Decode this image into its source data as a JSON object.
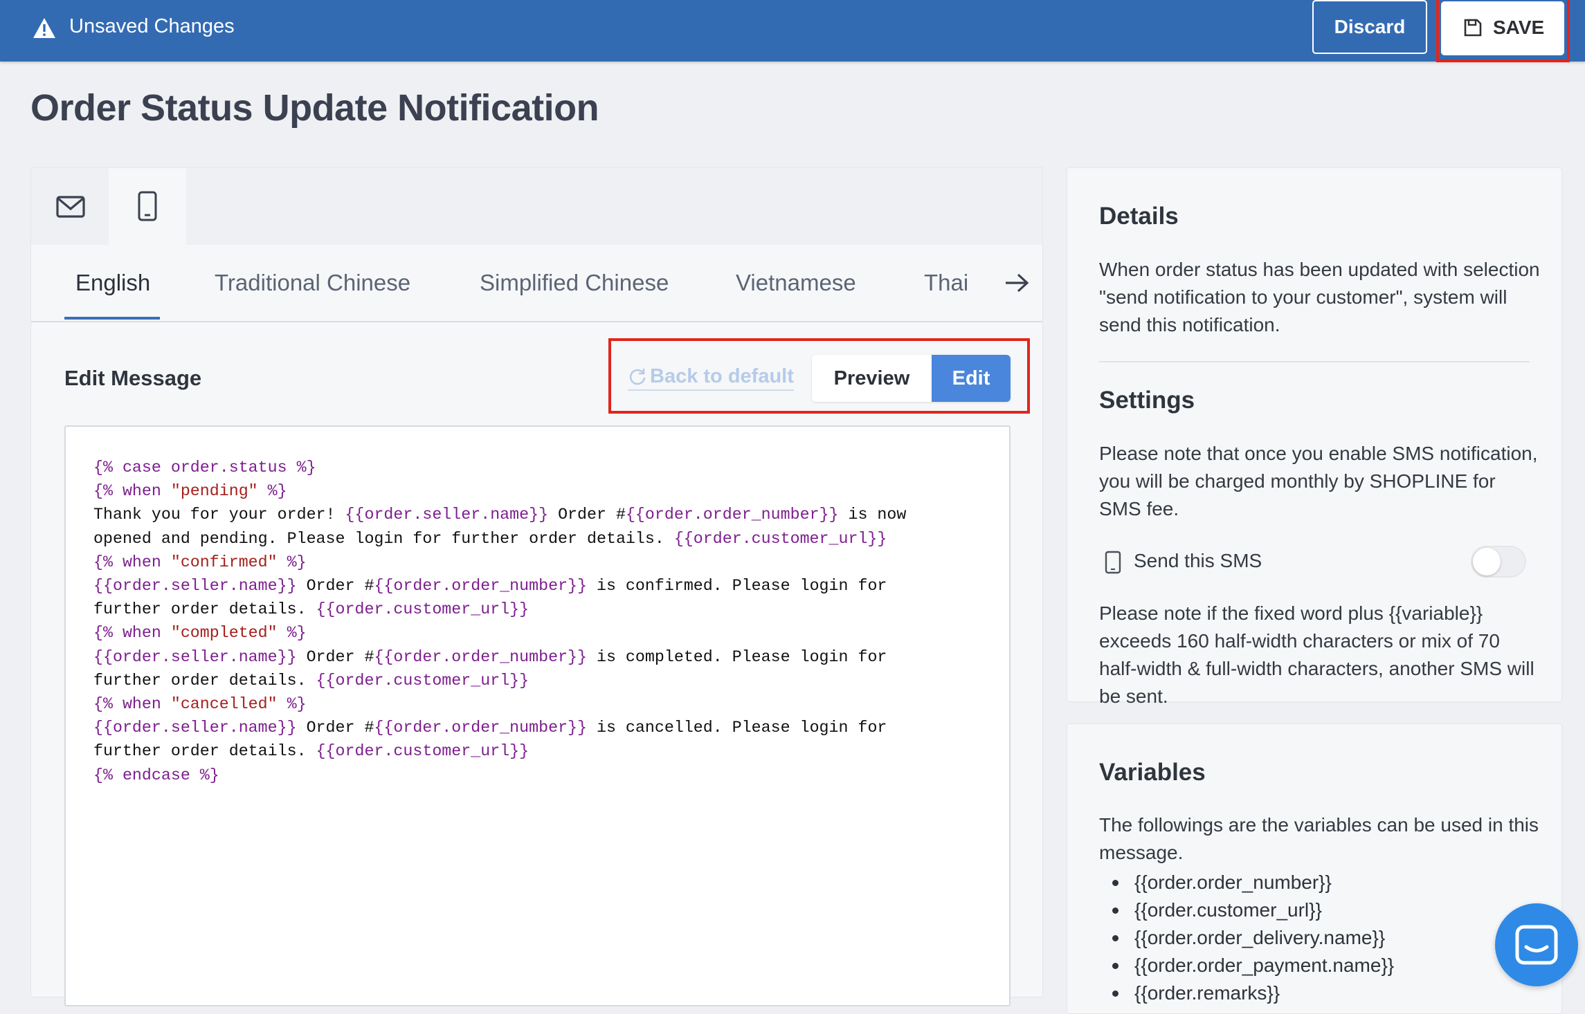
{
  "topbar": {
    "status": "Unsaved Changes",
    "discard_label": "Discard",
    "save_label": "SAVE",
    "background": "#336bb3"
  },
  "page": {
    "title": "Order Status Update Notification"
  },
  "channels": [
    {
      "icon": "envelope-icon",
      "active": false
    },
    {
      "icon": "mobile-phone-icon",
      "active": true
    }
  ],
  "languages": [
    "English",
    "Traditional Chinese",
    "Simplified Chinese",
    "Vietnamese",
    "Thai"
  ],
  "active_language": "English",
  "editor": {
    "heading": "Edit Message",
    "back_to_default": "Back to default",
    "preview_label": "Preview",
    "edit_label": "Edit",
    "mode": "Edit"
  },
  "message_code": [
    "{% case order.status %}",
    "{% when \"pending\" %}",
    "Thank you for your order! {{order.seller.name}} Order #{{order.order_number}} is now",
    "opened and pending. Please login for further order details. {{order.customer_url}}",
    "{% when \"confirmed\" %}",
    "{{order.seller.name}} Order #{{order.order_number}} is confirmed. Please login for",
    "further order details. {{order.customer_url}}",
    "{% when \"completed\" %}",
    "{{order.seller.name}} Order #{{order.order_number}} is completed. Please login for",
    "further order details. {{order.customer_url}}",
    "{% when \"cancelled\" %}",
    "{{order.seller.name}} Order #{{order.order_number}} is cancelled. Please login for",
    "further order details. {{order.customer_url}}",
    "{% endcase %}"
  ],
  "details": {
    "title": "Details",
    "text": "When order status has been updated with selection \"send notification to your customer\", system will send this notification."
  },
  "settings": {
    "title": "Settings",
    "text": "Please note that once you enable SMS notification, you will be charged monthly by SHOPLINE for SMS fee.",
    "send_sms_label": "Send this SMS",
    "send_sms_enabled": false,
    "note": "Please note if the fixed word plus {{variable}} exceeds 160 half-width characters or mix of 70 half-width & full-width characters, another SMS will be sent."
  },
  "variables": {
    "title": "Variables",
    "intro": "The followings are the variables can be used in this message.",
    "items": [
      "{{order.order_number}}",
      "{{order.customer_url}}",
      "{{order.order_delivery.name}}",
      "{{order.order_payment.name}}",
      "{{order.remarks}}"
    ]
  },
  "colors": {
    "accent": "#4a86dc",
    "highlight_box": "#e1251b",
    "liquid_tag": "#7d1f8f",
    "liquid_string": "#a5201c"
  }
}
